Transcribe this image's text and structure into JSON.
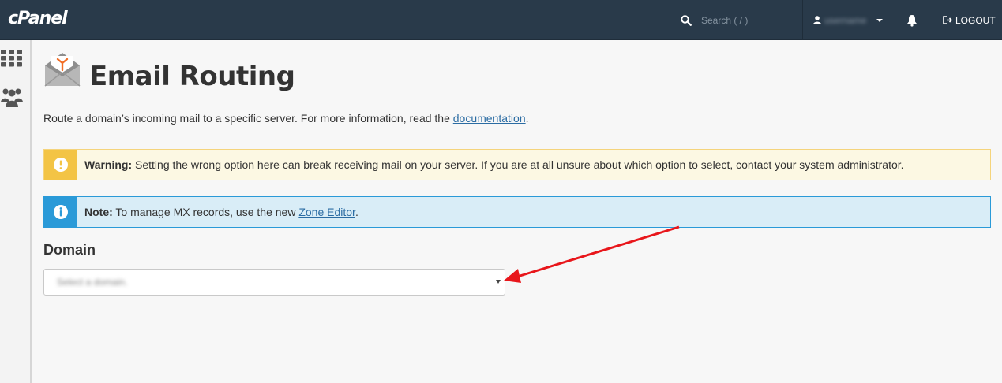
{
  "header": {
    "logo": "cPanel",
    "search_placeholder": "Search ( / )",
    "username": "username",
    "logout_label": "LOGOUT"
  },
  "sidebar": {
    "items": [
      {
        "icon": "grid-icon"
      },
      {
        "icon": "users-icon"
      }
    ]
  },
  "page": {
    "title": "Email Routing",
    "description_prefix": "Route a domain’s incoming mail to a specific server. For more information, read the ",
    "documentation_link": "documentation",
    "description_suffix": "."
  },
  "warning": {
    "label": "Warning:",
    "text": " Setting the wrong option here can break receiving mail on your server. If you are at all unsure about which option to select, contact your system administrator."
  },
  "note": {
    "label": "Note:",
    "text_prefix": " To manage MX records, use the new ",
    "link": "Zone Editor",
    "text_suffix": "."
  },
  "domain": {
    "label": "Domain",
    "placeholder": "Select a domain."
  },
  "colors": {
    "topbar": "#293a4a",
    "warning_badge": "#f3c445",
    "info_badge": "#2a9ad8",
    "annotation_arrow": "#e8161b",
    "accent_icon": "#f26d24"
  }
}
